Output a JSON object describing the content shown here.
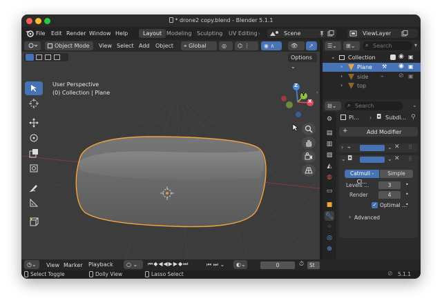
{
  "window": {
    "title": "* drone2 copy.blend - Blender 5.1.1"
  },
  "menu": {
    "file": "File",
    "edit": "Edit",
    "render": "Render",
    "window": "Window",
    "help": "Help"
  },
  "workspaces": [
    "Layout",
    "Modeling",
    "Sculpting",
    "UV Editing"
  ],
  "scene": {
    "name": "Scene"
  },
  "view_layer": {
    "name": "ViewLayer"
  },
  "viewport": {
    "mode": "Object Mode",
    "menus": [
      "View",
      "Select",
      "Add",
      "Object"
    ],
    "orientation": "Global",
    "options": "Options",
    "overlay_text_1": "User Perspective",
    "overlay_text_2": "(0) Collection | Plane",
    "gizmo": {
      "z": "Z",
      "y": "Y",
      "x": "X"
    }
  },
  "outliner": {
    "search_placeholder": "Search",
    "items": [
      "Collection",
      "Plane",
      "side",
      "top"
    ]
  },
  "properties": {
    "search_placeholder": "Search",
    "breadcrumb_object": "Pl...",
    "breadcrumb_modifier": "Subdi...",
    "add_modifier": "Add Modifier",
    "catmull": "Catmull - Cl...",
    "simple": "Simple",
    "levels_label": "Levels ...",
    "levels_value": "3",
    "render_label": "Render",
    "render_value": "4",
    "optimal_label": "Optimal ...",
    "advanced": "Advanced"
  },
  "timeline": {
    "menus": [
      "View",
      "Marker",
      "Playback"
    ],
    "frame": "0",
    "start": "St"
  },
  "status": {
    "select_toggle": "Select Toggle",
    "dolly_view": "Dolly View",
    "lasso_select": "Lasso Select",
    "version": "5.1.1"
  },
  "colors": {
    "accent": "#4772b3",
    "selection_outline": "#f4a23c",
    "viewport_bg": "#3c3c3c"
  }
}
